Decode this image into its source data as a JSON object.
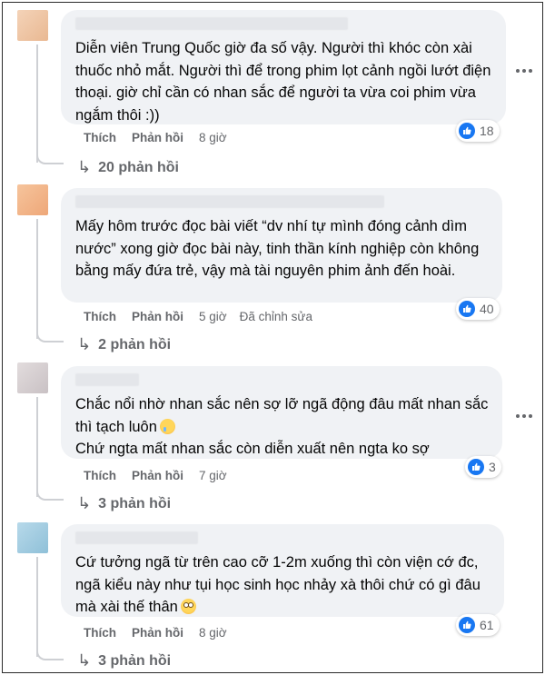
{
  "comments": [
    {
      "text": "Diễn viên Trung Quốc giờ đa số vậy. Người thì khóc còn xài thuốc nhỏ mắt. Người thì để trong phim lọt cảnh ngồi lướt điện thoại. giờ chỉ cần có nhan sắc để người ta vừa coi phim vừa ngắm thôi :))",
      "reactions": "18",
      "like": "Thích",
      "reply": "Phản hồi",
      "time": "8 giờ",
      "edited": "",
      "replies": "20 phản hồi",
      "avatar_color": "#f0c8a8"
    },
    {
      "text": "Mấy hôm trước đọc bài viết “dv nhí tự mình đóng cảnh dìm nước” xong giờ đọc bài này, tinh thần kính nghiệp còn không bằng mấy đứa trẻ, vậy mà tài nguyên phim ảnh đến hoài.",
      "reactions": "40",
      "like": "Thích",
      "reply": "Phản hồi",
      "time": "5 giờ",
      "edited": "Đã chỉnh sửa",
      "replies": "2 phản hồi",
      "avatar_color": "#f2b68a"
    },
    {
      "text_lines": [
        "Chắc nổi nhờ nhan sắc nên sợ lỡ ngã động đâu mất nhan sắc thì tạch luôn",
        "Chứ ngta mất nhan sắc còn diễn xuất nên ngta ko sợ"
      ],
      "reactions": "3",
      "like": "Thích",
      "reply": "Phản hồi",
      "time": "7 giờ",
      "edited": "",
      "replies": "3 phản hồi",
      "avatar_color": "#d9d2d4"
    },
    {
      "text": "Cứ tưởng ngã từ trên cao cỡ 1-2m xuống thì còn viện cớ đc, ngã kiểu này như tụi học sinh học nhảy xà thôi chứ có gì đâu mà xài thế thân",
      "reactions": "61",
      "like": "Thích",
      "reply": "Phản hồi",
      "time": "8 giờ",
      "edited": "",
      "replies": "3 phản hồi",
      "avatar_color": "#a9cfe2"
    }
  ],
  "colors": {
    "bubble": "#f0f2f5",
    "meta_text": "#65676b",
    "like_blue": "#1877f2"
  },
  "icons": {
    "like": "thumbs-up-icon",
    "more": "more-options-icon",
    "reply_arrow": "reply-arrow-icon"
  }
}
